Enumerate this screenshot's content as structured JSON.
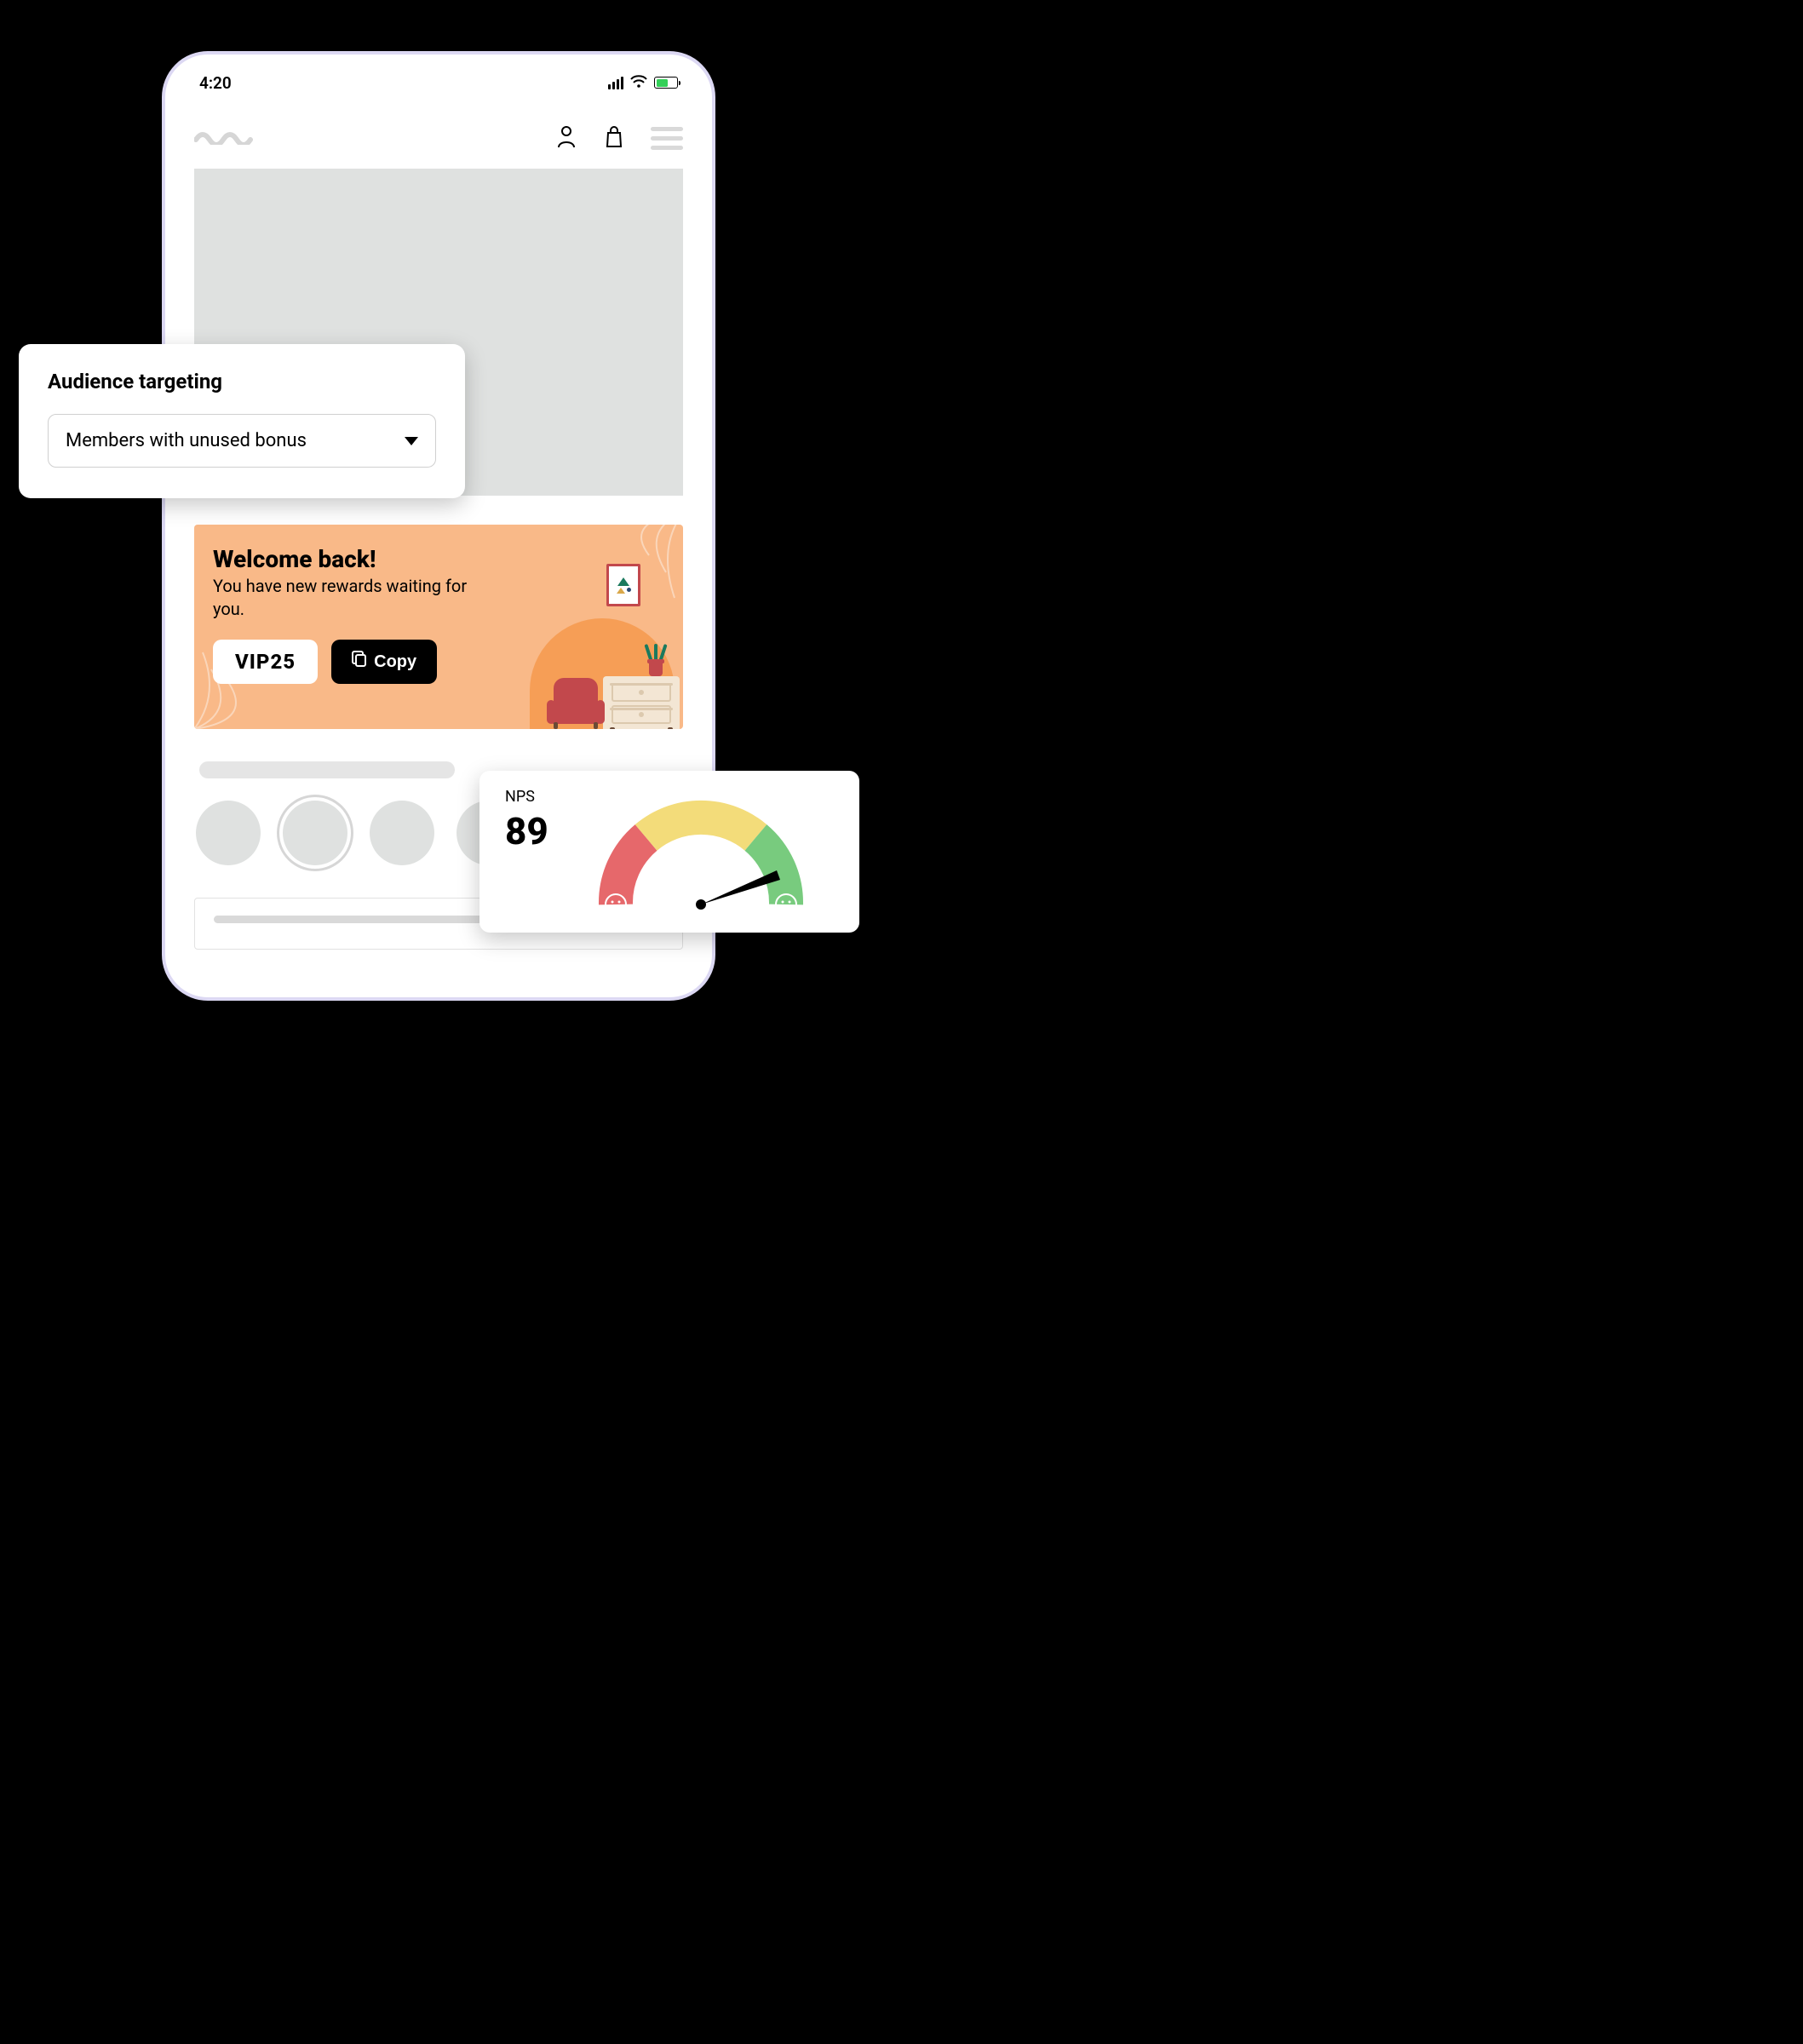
{
  "statusbar": {
    "time": "4:20"
  },
  "audience": {
    "title": "Audience targeting",
    "selected": "Members with unused bonus"
  },
  "promo": {
    "title": "Welcome back!",
    "subtitle": "You have new rewards waiting for you.",
    "code": "VIP25",
    "copy_label": "Copy"
  },
  "nps": {
    "label": "NPS",
    "value": "89"
  }
}
